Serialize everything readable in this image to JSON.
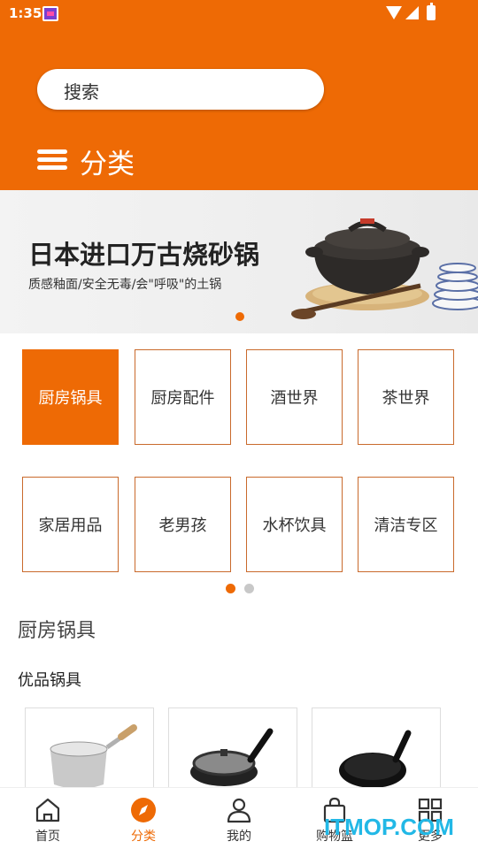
{
  "status_bar": {
    "time": "1:35"
  },
  "search": {
    "placeholder": "搜索"
  },
  "header": {
    "title": "分类"
  },
  "banner": {
    "title": "日本进口万古烧砂锅",
    "subtitle": "质感釉面/安全无毒/会\"呼吸\"的土锅"
  },
  "categories": [
    {
      "label": "厨房锅具",
      "active": true
    },
    {
      "label": "厨房配件",
      "active": false
    },
    {
      "label": "酒世界",
      "active": false
    },
    {
      "label": "茶世界",
      "active": false
    },
    {
      "label": "家居用品",
      "active": false
    },
    {
      "label": "老男孩",
      "active": false
    },
    {
      "label": "水杯饮具",
      "active": false
    },
    {
      "label": "清洁专区",
      "active": false
    }
  ],
  "category_pager": {
    "current_page": 1,
    "total_pages": 2
  },
  "section": {
    "title": "厨房锅具",
    "subtitle": "优品锅具"
  },
  "products": [
    {
      "icon": "saucepan-icon"
    },
    {
      "icon": "lidded-frying-pan-icon"
    },
    {
      "icon": "frying-pan-icon"
    }
  ],
  "tab_bar": {
    "tabs": [
      {
        "label": "首页",
        "icon": "home-icon",
        "active": false
      },
      {
        "label": "分类",
        "icon": "compass-icon",
        "active": true
      },
      {
        "label": "我的",
        "icon": "user-icon",
        "active": false
      },
      {
        "label": "购物篮",
        "icon": "shopping-bag-icon",
        "active": false
      },
      {
        "label": "更多",
        "icon": "grid-icon",
        "active": false
      }
    ]
  },
  "watermark": "ITMOP.COM",
  "colors": {
    "brand": "#ee6a05",
    "tile_border": "#c96a2c",
    "inactive_dot": "#c8c8c8",
    "watermark": "#22b8e6"
  }
}
